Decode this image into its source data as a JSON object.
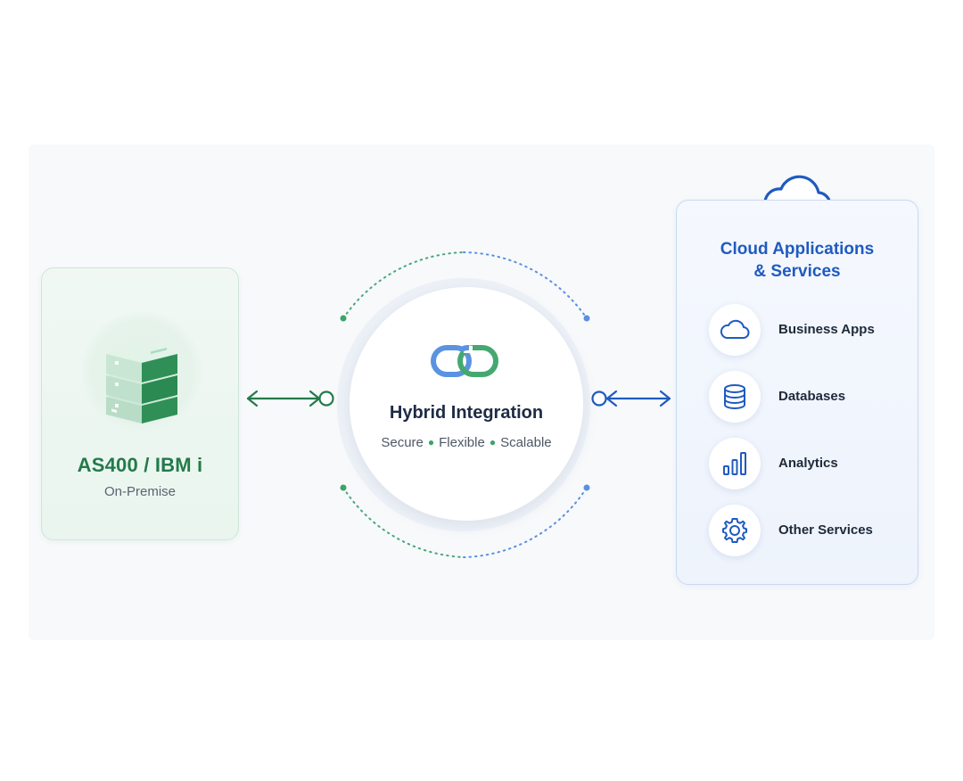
{
  "left_card": {
    "title": "AS400 / IBM i",
    "subtitle": "On-Premise",
    "icon": "server-stack-icon"
  },
  "hub": {
    "title": "Hybrid Integration",
    "tags": [
      "Secure",
      "Flexible",
      "Scalable"
    ],
    "icon": "link-chain-icon"
  },
  "right_card": {
    "title_line1": "Cloud Applications",
    "title_line2": "& Services",
    "icon": "cloud-icon",
    "services": [
      {
        "label": "Business Apps",
        "icon": "cloud-icon"
      },
      {
        "label": "Databases",
        "icon": "database-icon"
      },
      {
        "label": "Analytics",
        "icon": "bar-chart-icon"
      },
      {
        "label": "Other Services",
        "icon": "gear-icon"
      }
    ]
  },
  "colors": {
    "green": "#237a4a",
    "blue": "#1f5bbf",
    "text_dark": "#1d2b44"
  }
}
